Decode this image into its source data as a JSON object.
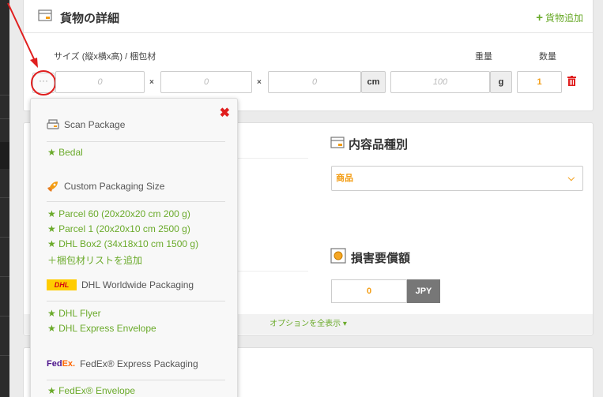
{
  "cargo": {
    "title": "貨物の詳細",
    "add_label": "貨物追加",
    "size_label": "サイズ (縦x横x高) / 梱包材",
    "weight_label": "重量",
    "qty_label": "数量",
    "dims": [
      "0",
      "0",
      "0"
    ],
    "times": "×",
    "dim_unit": "cm",
    "weight_value": "100",
    "weight_unit": "g",
    "qty_value": "1",
    "dots": "···"
  },
  "contents": {
    "title": "内容品種別",
    "selected": "商品"
  },
  "insurance": {
    "title": "損害要償額",
    "value": "0",
    "currency": "JPY"
  },
  "options_toggle": "オプションを全表示 ▾",
  "dropdown": {
    "close": "✖",
    "sections": {
      "scan_title": "Scan Package",
      "scan_items": [
        "★ Bedal"
      ],
      "custom_title": "Custom Packaging Size",
      "custom_items": [
        "★ Parcel 60 (20x20x20 cm 200 g)",
        "★ Parcel 1 (20x20x10 cm 2500 g)",
        "★ DHL Box2 (34x18x10 cm 1500 g)"
      ],
      "custom_add": "＋梱包材リストを追加",
      "dhl_title": "DHL Worldwide Packaging",
      "dhl_logo": "DHL",
      "dhl_items": [
        "★ DHL Flyer",
        "★ DHL Express Envelope"
      ],
      "fedex_title": "FedEx® Express Packaging",
      "fedex_logo_a": "Fed",
      "fedex_logo_b": "Ex.",
      "fedex_items": [
        "★ FedEx® Envelope"
      ]
    }
  },
  "colors": {
    "accent_green": "#6aaa2a",
    "accent_orange": "#f39c12",
    "danger_red": "#e01e1e"
  }
}
